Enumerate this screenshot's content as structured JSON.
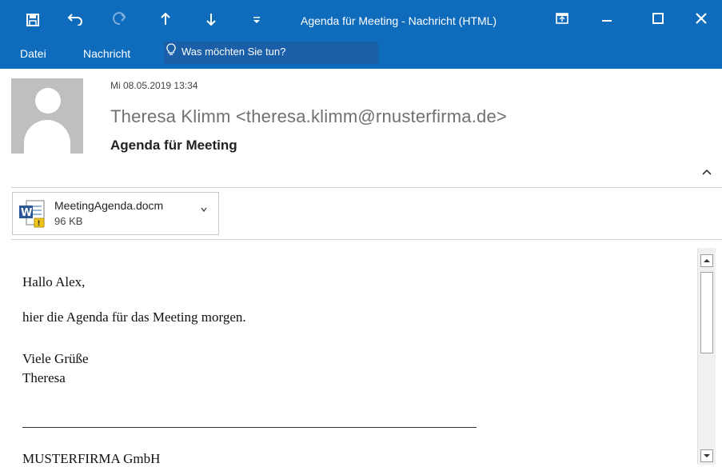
{
  "window": {
    "title": "Agenda für Meeting - Nachricht (HTML)",
    "icons": [
      "save-icon",
      "undo-icon",
      "redo-icon",
      "up-arrow-icon",
      "down-arrow-icon",
      "customize-icon",
      "restore-ribbon-icon",
      "minimize-icon",
      "maximize-icon",
      "close-icon"
    ]
  },
  "menu": {
    "file": "Datei",
    "message": "Nachricht",
    "tell_me": "Was möchten Sie tun?"
  },
  "message": {
    "date": "Mi 08.05.2019 13:34",
    "from": "Theresa Klimm <theresa.klimm@rnusterfirma.de>",
    "subject": "Agenda für Meeting"
  },
  "attachment": {
    "name": "MeetingAgenda.docm",
    "size": "96 KB"
  },
  "body": {
    "greeting": "Hallo Alex,",
    "line1": "hier die Agenda für das Meeting morgen.",
    "closing": "Viele Grüße",
    "signature_name": "Theresa",
    "company": "MUSTERFIRMA GmbH"
  },
  "colors": {
    "accent": "#0f6cbd"
  }
}
